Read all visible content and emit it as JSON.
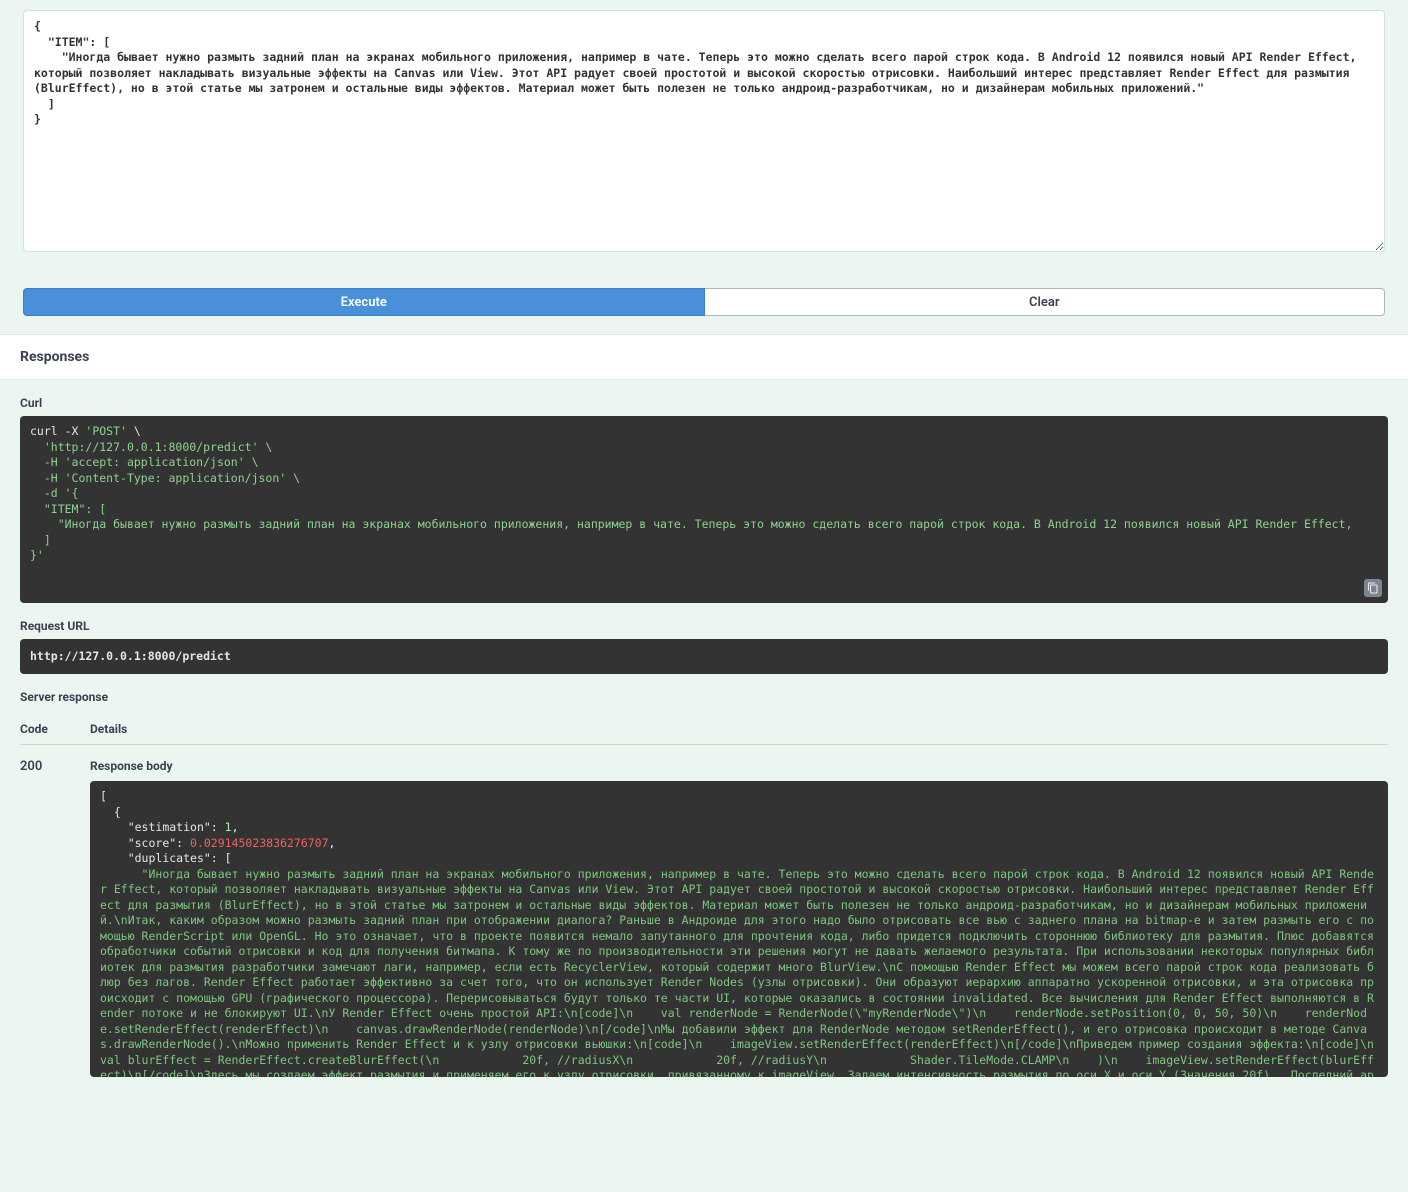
{
  "param_textarea_value": "{\n  \"ITEM\": [\n    \"Иногда бывает нужно размыть задний план на экранах мобильного приложения, например в чате. Теперь это можно сделать всего парой строк кода. В Android 12 появился новый API Render Effect, который позволяет накладывать визуальные эффекты на Canvas или View. Этот API радует своей простотой и высокой скоростью отрисовки. Наибольший интерес представляет Render Effect для размытия (BlurEffect), но в этой статье мы затронем и остальные виды эффектов. Материал может быть полезен не только андроид-разработчикам, но и дизайнерам мобильных приложений.\"\n  ]\n}",
  "buttons": {
    "execute": "Execute",
    "clear": "Clear"
  },
  "responses_heading": "Responses",
  "labels": {
    "curl": "Curl",
    "request_url": "Request URL",
    "server_response": "Server response",
    "code": "Code",
    "details": "Details",
    "response_body": "Response body"
  },
  "curl": {
    "line1_a": "curl -X ",
    "line1_b": "'POST'",
    "line1_c": " \\",
    "line2": "  'http://127.0.0.1:8000/predict' \\",
    "line3": "  -H 'accept: application/json' \\",
    "line4": "  -H 'Content-Type: application/json' \\",
    "line5": "  -d '{",
    "line6": "  \"ITEM\": [",
    "line7": "    \"Иногда бывает нужно размыть задний план на экранах мобильного приложения, например в чате. Теперь это можно сделать всего парой строк кода. В Android 12 появился новый API Render Effect,",
    "line8": "  ]",
    "line9": "}'"
  },
  "request_url": "http://127.0.0.1:8000/predict",
  "status_code": "200",
  "response_body": {
    "line1": "[",
    "line2": "  {",
    "line3_k": "    \"estimation\": ",
    "line3_v": "1",
    "line3_c": ",",
    "line4_k": "    \"score\": ",
    "line4_v": "0.029145023836276707",
    "line4_c": ",",
    "line5_k": "    \"duplicates\": [",
    "line6": "      \"Иногда бывает нужно размыть задний план на экранах мобильного приложения, например в чате. Теперь это можно сделать всего парой строк кода. В Android 12 появился новый API Render Effect, который позволяет накладывать визуальные эффекты на Canvas или View. Этот API радует своей простотой и высокой скоростью отрисовки. Наибольший интерес представляет Render Effect для размытия (BlurEffect), но в этой статье мы затронем и остальные виды эффектов. Материал может быть полезен не только андроид-разработчикам, но и дизайнерам мобильных приложений.\\nИтак, каким образом можно размыть задний план при отображении диалога? Раньше в Андроиде для этого надо было отрисовать все вью с заднего плана на bitmap-е и затем размыть его с помощью RenderScript или OpenGL. Но это означает, что в проекте появится немало запутанного для прочтения кода, либо придется подключить стороннюю библиотеку для размытия. Плюс добавятся обработчики событий отрисовки и код для получения битмапа. К тому же по производительности эти решения могут не давать желаемого результата. При использовании некоторых популярных библиотек для размытия разработчики замечают лаги, например, если есть RecyclerView, который содержит много BlurView.\\nС помощью Render Effect мы можем всего парой строк кода реализовать блюр без лагов. Render Effect работает эффективно за счет того, что он использует Render Nodes (узлы отрисовки). Они образуют иерархию аппаратно ускоренной отрисовки, и эта отрисовка происходит с помощью GPU (графического процессора). Перерисовываться будут только те части UI, которые оказались в состоянии invalidated. Все вычисления для Render Effect выполняются в Render потоке и не блокируют UI.\\nУ Render Effect очень простой API:\\n[code]\\n    val renderNode = RenderNode(\\\"myRenderNode\\\")\\n    renderNode.setPosition(0, 0, 50, 50)\\n    renderNode.setRenderEffect(renderEffect)\\n    canvas.drawRenderNode(renderNode)\\n[/code]\\nМы добавили эффект для RenderNode методом setRenderEffect(), и его отрисовка происходит в методе Canvas.drawRenderNode().\\nМожно применить Render Effect и к узлу отрисовки вьюшки:\\n[code]\\n    imageView.setRenderEffect(renderEffect)\\n[/code]\\nПриведем пример создания эффекта:\\n[code]\\n    val blurEffect = RenderEffect.createBlurEffect(\\n            20f, //radiusX\\n            20f, //radiusY\\n            Shader.TileMode.CLAMP\\n    )\\n    imageView.setRenderEffect(blurEffect)\\n[/code]\\nЗдесь мы создаем эффект размытия и применяем его к узлу отрисовки, привязанному к imageView. Задаем интенсивность размытия по оси X и оси Y (Значения 20f) . Последний аргумент — Shader.TileMode — определяет то, как будет выглядеть эффект на краях отрисовываемой области.\\nЕсли применить размытие к корневому layout-у, то будут размыты все вьюшки: и кнопка, и ползунки.\\nВарианты значений TileMode:\\n  MIRROR. Используются зеркальные отражения изображе"
  }
}
